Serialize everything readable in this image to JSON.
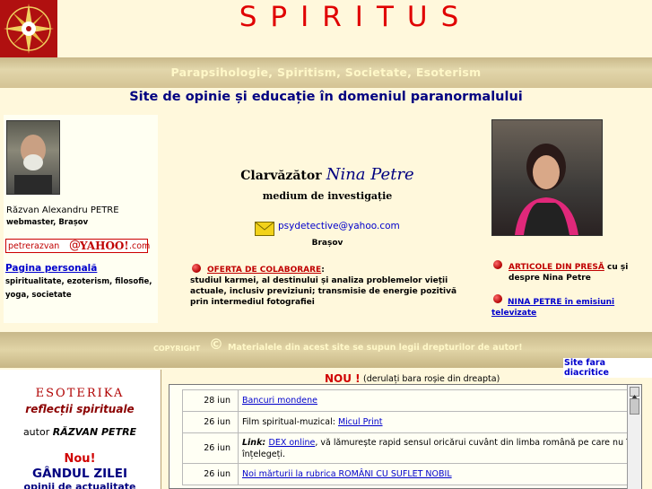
{
  "header": {
    "title": "SPIRITUS",
    "logo_icon": "compass-star-icon",
    "tagline": "Parapsihologie, Spiritism, Societate, Esoterism",
    "subtitle": "Site de opinie și educație în domeniul paranormalului"
  },
  "left_panel": {
    "name": "Răzvan Alexandru PETRE",
    "role": "webmaster, Brașov",
    "yahoo_user": "petrerazvan",
    "yahoo_at": "@",
    "yahoo_brand": "YAHOO!",
    "yahoo_domain": ".com",
    "personal_link": "Pagina personală",
    "topics": "spiritualitate, ezoterism, filosofie, yoga, societate"
  },
  "center": {
    "prefix": "Clarvăzător",
    "name": "Nina Petre",
    "role": "medium de investigație",
    "email": "psydetective@yahoo.com",
    "city": "Brașov",
    "offer_link": "OFERTA DE COLABORARE",
    "offer_colon": ":",
    "offer_text": "studiul karmei, al destinului și analiza problemelor vieții actuale, inclusiv previziuni; transmisie de energie pozitivă prin intermediul fotografiei"
  },
  "right_panel": {
    "articles_link": "ARTICOLE DIN PRESĂ",
    "articles_suffix": "cu și despre Nina Petre",
    "tv_link": "NINA PETRE în emisiuni televizate"
  },
  "copyright": {
    "label": "COPYRIGHT",
    "symbol": "©",
    "text": "Materialele din acest site se supun legii drepturilor de autor!",
    "diacritics_link": "Site fara diacritice"
  },
  "esoterika": {
    "title": "ESOTERIKA",
    "subtitle": "reflecții spirituale",
    "author_prefix": "autor",
    "author": "RĂZVAN PETRE",
    "new_label": "Nou!",
    "thought": "GÂNDUL ZILEI",
    "thought_sub": "opinii de actualitate"
  },
  "news": {
    "new_label": "NOU !",
    "hint": "(derulați bara roșie din dreapta)",
    "rows": [
      {
        "date": "28 iun",
        "link": "Bancuri mondene",
        "prefix": "",
        "suffix": ""
      },
      {
        "date": "26 iun",
        "link": "Micul Print",
        "prefix": "Film spiritual-muzical: ",
        "suffix": ""
      },
      {
        "date": "26 iun",
        "link": "DEX online",
        "prefix": "Link: ",
        "suffix": ", vă lămurește rapid sensul oricărui cuvânt din limba română pe care nu îl înțelegeți."
      },
      {
        "date": "26 iun",
        "link": "Noi mărturii la rubrica ROMÂNI CU SUFLET NOBIL",
        "prefix": "",
        "suffix": ""
      }
    ]
  },
  "colors": {
    "title": "#e00000",
    "tagline": "#fff8c8",
    "subtitle": "#000080",
    "link": "#0000cc",
    "band": "#d4c394",
    "background": "#fff8dc"
  }
}
